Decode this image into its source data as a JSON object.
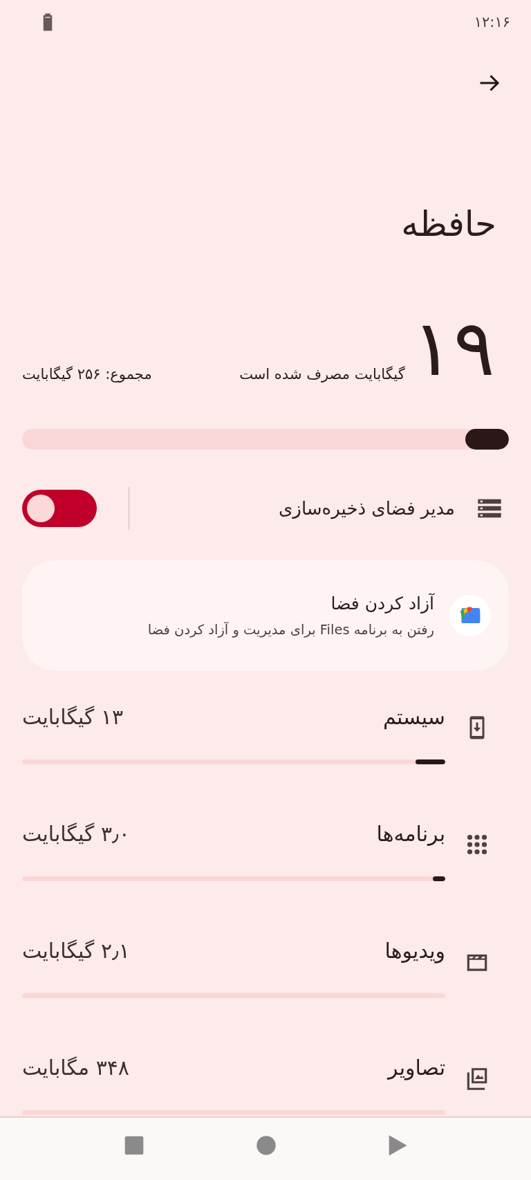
{
  "status_bar": {
    "time": "۱۲:۱۶"
  },
  "title": "حافظه",
  "usage": {
    "amount": "۱۹",
    "used_label": "گیگابایت مصرف شده است",
    "total_label": "مجموع: ۲۵۶ گیگابایت",
    "level": 0.09
  },
  "storage_manager": {
    "label": "مدیر فضای ذخیره‌سازی",
    "on": true
  },
  "free_up_card": {
    "title": "آزاد کردن فضا",
    "subtitle": "رفتن به برنامه Files برای مدیریت و آزاد کردن فضا"
  },
  "categories": [
    {
      "kind": "system",
      "label": "سیستم",
      "size": "۱۳ گیگابایت",
      "level": 0.07
    },
    {
      "kind": "apps",
      "label": "برنامه‌ها",
      "size": "۳٫۰ گیگابایت",
      "level": 0.03
    },
    {
      "kind": "videos",
      "label": "ویدیوها",
      "size": "۲٫۱ گیگابایت"
    },
    {
      "kind": "images",
      "label": "تصاویر",
      "size": "۳۴۸ مگابایت"
    }
  ]
}
